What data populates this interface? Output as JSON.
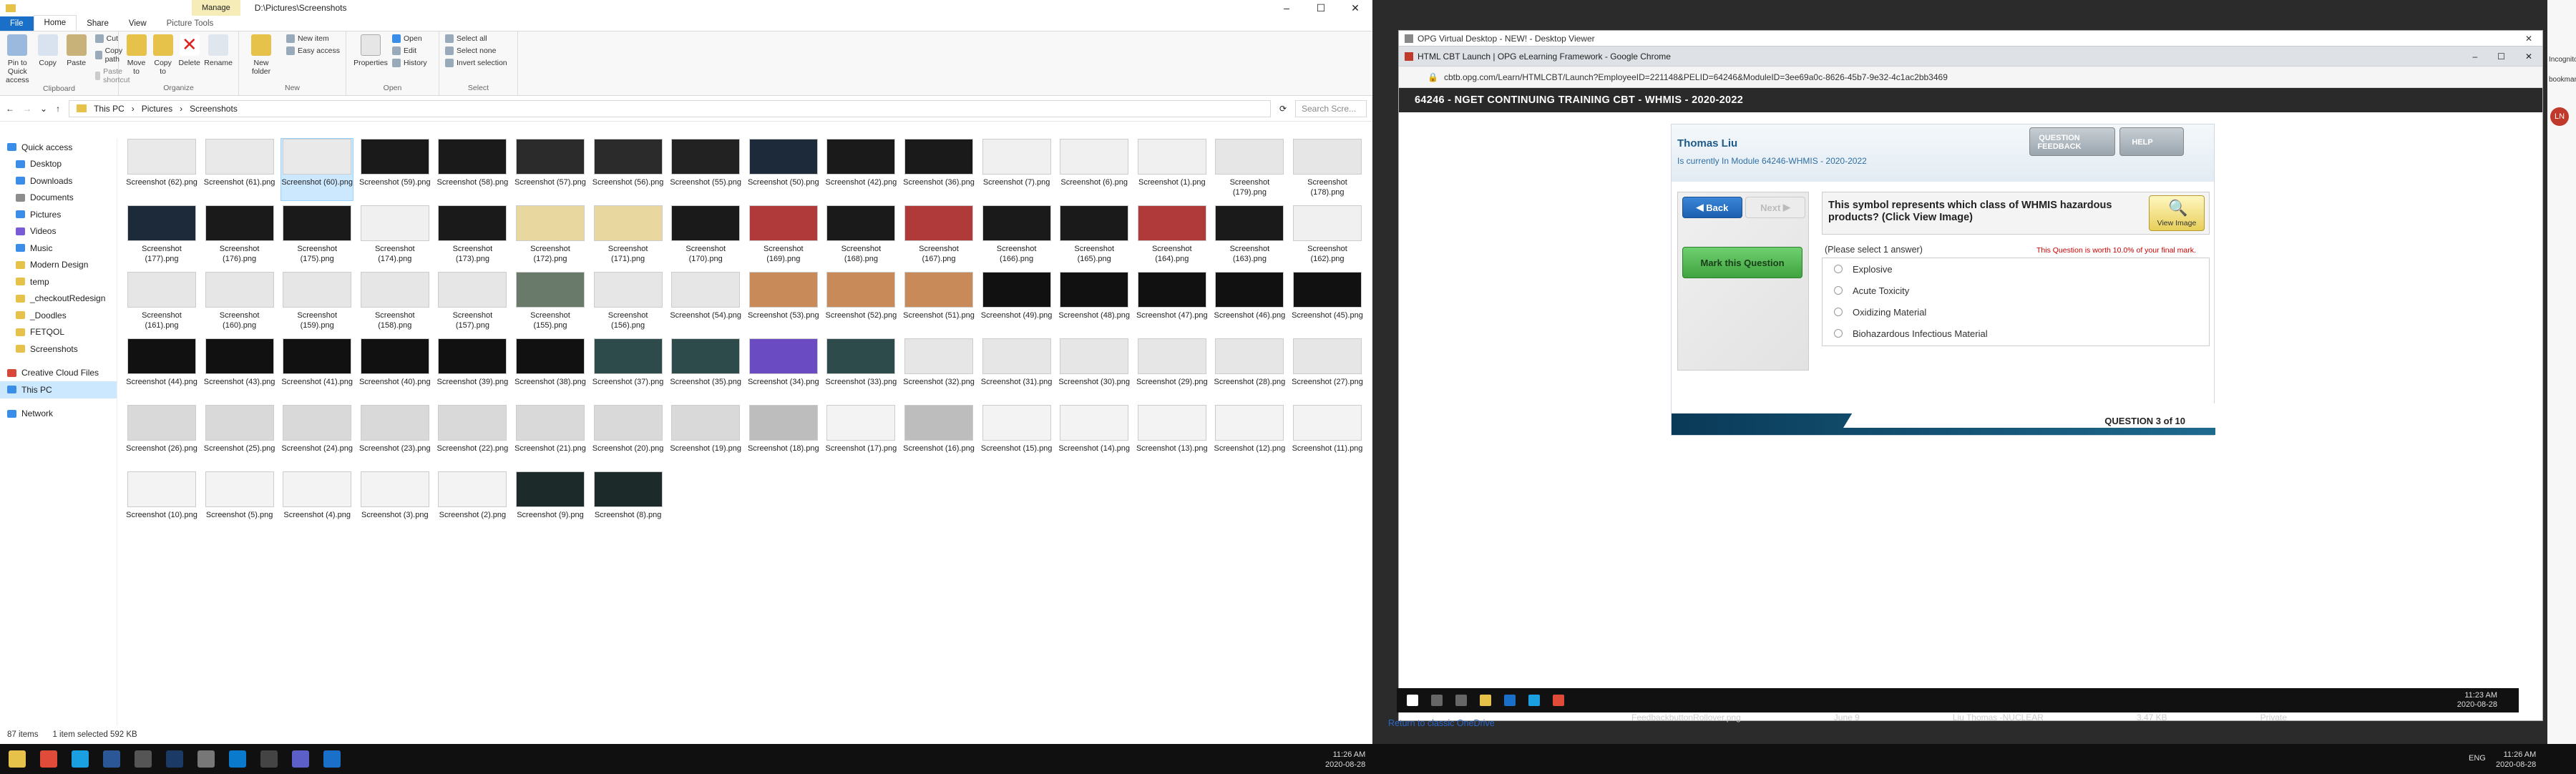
{
  "explorer": {
    "title_path": "D:\\Pictures\\Screenshots",
    "manage_tab": "Manage",
    "picture_tools": "Picture Tools",
    "tabs": [
      "File",
      "Home",
      "Share",
      "View"
    ],
    "ribbon": {
      "clipboard": {
        "pin": "Pin to Quick access",
        "copy": "Copy",
        "paste": "Paste",
        "cut": "Cut",
        "copy_path": "Copy path",
        "paste_shortcut": "Paste shortcut",
        "group": "Clipboard"
      },
      "organize": {
        "move": "Move to",
        "copy": "Copy to",
        "delete": "Delete",
        "rename": "Rename",
        "group": "Organize"
      },
      "new": {
        "new_folder": "New folder",
        "new_item": "New item",
        "easy_access": "Easy access",
        "group": "New"
      },
      "open": {
        "properties": "Properties",
        "open": "Open",
        "edit": "Edit",
        "history": "History",
        "group": "Open"
      },
      "select": {
        "select_all": "Select all",
        "select_none": "Select none",
        "invert": "Invert selection",
        "group": "Select"
      }
    },
    "breadcrumb": [
      "This PC",
      "Pictures",
      "Screenshots"
    ],
    "search_placeholder": "Search Scre...",
    "nav": [
      {
        "label": "Quick access",
        "color": "#3b8ee8"
      },
      {
        "label": "Desktop",
        "color": "#3b8ee8"
      },
      {
        "label": "Downloads",
        "color": "#3b8ee8"
      },
      {
        "label": "Documents",
        "color": "#8d8d8d"
      },
      {
        "label": "Pictures",
        "color": "#3b8ee8"
      },
      {
        "label": "Videos",
        "color": "#7a5bd6"
      },
      {
        "label": "Music",
        "color": "#3b8ee8"
      },
      {
        "label": "Modern Design",
        "color": "#e7c24a"
      },
      {
        "label": "temp",
        "color": "#e7c24a"
      },
      {
        "label": "_checkoutRedesign",
        "color": "#e7c24a"
      },
      {
        "label": "_Doodles",
        "color": "#e7c24a"
      },
      {
        "label": "FETQOL",
        "color": "#e7c24a"
      },
      {
        "label": "Screenshots",
        "color": "#e7c24a"
      },
      {
        "label": "Creative Cloud Files",
        "color": "#d7473a"
      },
      {
        "label": "This PC",
        "color": "#3b8ee8"
      },
      {
        "label": "Network",
        "color": "#3b8ee8"
      }
    ],
    "files": [
      {
        "label": "Screenshot (62).png",
        "thumb": "#e9e9e9"
      },
      {
        "label": "Screenshot (61).png",
        "thumb": "#e9e9e9"
      },
      {
        "label": "Screenshot (60).png",
        "thumb": "#e9e9e9"
      },
      {
        "label": "Screenshot (59).png",
        "thumb": "#1a1a1a"
      },
      {
        "label": "Screenshot (58).png",
        "thumb": "#1a1a1a"
      },
      {
        "label": "Screenshot (57).png",
        "thumb": "#2b2b2b"
      },
      {
        "label": "Screenshot (56).png",
        "thumb": "#2b2b2b"
      },
      {
        "label": "Screenshot (55).png",
        "thumb": "#222"
      },
      {
        "label": "Screenshot (50).png",
        "thumb": "#1c2a3a"
      },
      {
        "label": "Screenshot (42).png",
        "thumb": "#1a1a1a"
      },
      {
        "label": "Screenshot (36).png",
        "thumb": "#1a1a1a"
      },
      {
        "label": "Screenshot (7).png",
        "thumb": "#f0f0f0"
      },
      {
        "label": "Screenshot (6).png",
        "thumb": "#f0f0f0"
      },
      {
        "label": "Screenshot (1).png",
        "thumb": "#f0f0f0"
      },
      {
        "label": "Screenshot (179).png",
        "thumb": "#e6e6e6"
      },
      {
        "label": "Screenshot (178).png",
        "thumb": "#e6e6e6"
      },
      {
        "label": "Screenshot (177).png",
        "thumb": "#1c2a3a"
      },
      {
        "label": "Screenshot (176).png",
        "thumb": "#1a1a1a"
      },
      {
        "label": "Screenshot (175).png",
        "thumb": "#1a1a1a"
      },
      {
        "label": "Screenshot (174).png",
        "thumb": "#f0f0f0"
      },
      {
        "label": "Screenshot (173).png",
        "thumb": "#1a1a1a"
      },
      {
        "label": "Screenshot (172).png",
        "thumb": "#e8d8a0"
      },
      {
        "label": "Screenshot (171).png",
        "thumb": "#e8d8a0"
      },
      {
        "label": "Screenshot (170).png",
        "thumb": "#1a1a1a"
      },
      {
        "label": "Screenshot (169).png",
        "thumb": "#b03a3a"
      },
      {
        "label": "Screenshot (168).png",
        "thumb": "#1a1a1a"
      },
      {
        "label": "Screenshot (167).png",
        "thumb": "#b03a3a"
      },
      {
        "label": "Screenshot (166).png",
        "thumb": "#1a1a1a"
      },
      {
        "label": "Screenshot (165).png",
        "thumb": "#1a1a1a"
      },
      {
        "label": "Screenshot (164).png",
        "thumb": "#b03a3a"
      },
      {
        "label": "Screenshot (163).png",
        "thumb": "#1a1a1a"
      },
      {
        "label": "Screenshot (162).png",
        "thumb": "#f0f0f0"
      },
      {
        "label": "Screenshot (161).png",
        "thumb": "#e6e6e6"
      },
      {
        "label": "Screenshot (160).png",
        "thumb": "#e6e6e6"
      },
      {
        "label": "Screenshot (159).png",
        "thumb": "#e6e6e6"
      },
      {
        "label": "Screenshot (158).png",
        "thumb": "#e6e6e6"
      },
      {
        "label": "Screenshot (157).png",
        "thumb": "#e6e6e6"
      },
      {
        "label": "Screenshot (155).png",
        "thumb": "#6a7a6a"
      },
      {
        "label": "Screenshot (156).png",
        "thumb": "#e6e6e6"
      },
      {
        "label": "Screenshot (54).png",
        "thumb": "#e6e6e6"
      },
      {
        "label": "Screenshot (53).png",
        "thumb": "#c98a5a"
      },
      {
        "label": "Screenshot (52).png",
        "thumb": "#c98a5a"
      },
      {
        "label": "Screenshot (51).png",
        "thumb": "#c98a5a"
      },
      {
        "label": "Screenshot (49).png",
        "thumb": "#111"
      },
      {
        "label": "Screenshot (48).png",
        "thumb": "#111"
      },
      {
        "label": "Screenshot (47).png",
        "thumb": "#111"
      },
      {
        "label": "Screenshot (46).png",
        "thumb": "#111"
      },
      {
        "label": "Screenshot (45).png",
        "thumb": "#111"
      },
      {
        "label": "Screenshot (44).png",
        "thumb": "#111"
      },
      {
        "label": "Screenshot (43).png",
        "thumb": "#111"
      },
      {
        "label": "Screenshot (41).png",
        "thumb": "#111"
      },
      {
        "label": "Screenshot (40).png",
        "thumb": "#111"
      },
      {
        "label": "Screenshot (39).png",
        "thumb": "#111"
      },
      {
        "label": "Screenshot (38).png",
        "thumb": "#111"
      },
      {
        "label": "Screenshot (37).png",
        "thumb": "#2e4b4b"
      },
      {
        "label": "Screenshot (35).png",
        "thumb": "#2e4b4b"
      },
      {
        "label": "Screenshot (34).png",
        "thumb": "#6b4bc2"
      },
      {
        "label": "Screenshot (33).png",
        "thumb": "#2e4b4b"
      },
      {
        "label": "Screenshot (32).png",
        "thumb": "#e6e6e6"
      },
      {
        "label": "Screenshot (31).png",
        "thumb": "#e6e6e6"
      },
      {
        "label": "Screenshot (30).png",
        "thumb": "#e6e6e6"
      },
      {
        "label": "Screenshot (29).png",
        "thumb": "#e6e6e6"
      },
      {
        "label": "Screenshot (28).png",
        "thumb": "#e6e6e6"
      },
      {
        "label": "Screenshot (27).png",
        "thumb": "#e6e6e6"
      },
      {
        "label": "Screenshot (26).png",
        "thumb": "#d9d9d9"
      },
      {
        "label": "Screenshot (25).png",
        "thumb": "#d9d9d9"
      },
      {
        "label": "Screenshot (24).png",
        "thumb": "#d9d9d9"
      },
      {
        "label": "Screenshot (23).png",
        "thumb": "#d9d9d9"
      },
      {
        "label": "Screenshot (22).png",
        "thumb": "#d9d9d9"
      },
      {
        "label": "Screenshot (21).png",
        "thumb": "#d9d9d9"
      },
      {
        "label": "Screenshot (20).png",
        "thumb": "#d9d9d9"
      },
      {
        "label": "Screenshot (19).png",
        "thumb": "#d9d9d9"
      },
      {
        "label": "Screenshot (18).png",
        "thumb": "#bdbdbd"
      },
      {
        "label": "Screenshot (17).png",
        "thumb": "#f3f3f3"
      },
      {
        "label": "Screenshot (16).png",
        "thumb": "#bdbdbd"
      },
      {
        "label": "Screenshot (15).png",
        "thumb": "#f3f3f3"
      },
      {
        "label": "Screenshot (14).png",
        "thumb": "#f3f3f3"
      },
      {
        "label": "Screenshot (13).png",
        "thumb": "#f3f3f3"
      },
      {
        "label": "Screenshot (12).png",
        "thumb": "#f3f3f3"
      },
      {
        "label": "Screenshot (11).png",
        "thumb": "#f3f3f3"
      },
      {
        "label": "Screenshot (10).png",
        "thumb": "#f3f3f3"
      },
      {
        "label": "Screenshot (5).png",
        "thumb": "#f3f3f3"
      },
      {
        "label": "Screenshot (4).png",
        "thumb": "#f3f3f3"
      },
      {
        "label": "Screenshot (3).png",
        "thumb": "#f3f3f3"
      },
      {
        "label": "Screenshot (2).png",
        "thumb": "#f3f3f3"
      },
      {
        "label": "Screenshot (9).png",
        "thumb": "#1c2a2a"
      },
      {
        "label": "Screenshot (8).png",
        "thumb": "#1c2a2a"
      }
    ],
    "selected_index": 2,
    "status": {
      "count": "87 items",
      "selected": "1 item selected  592 KB"
    }
  },
  "vd": {
    "title": "OPG Virtual Desktop - NEW! - Desktop Viewer",
    "chrome_title": "HTML CBT Launch | OPG eLearning Framework - Google Chrome",
    "url": "cbtb.opg.com/Learn/HTMLCBT/Launch?EmployeeID=221148&PELID=64246&ModuleID=3ee69a0c-8626-45b7-9e32-4c1ac2bb3469",
    "course_title": "64246 - NGET CONTINUING TRAINING CBT - WHMIS - 2020-2022",
    "user_name": "Thomas Liu",
    "module_line": "Is currently In Module 64246-WHMIS - 2020-2022",
    "feedback_label": "QUESTION FEEDBACK",
    "help_label": "HELP",
    "back_label": "Back",
    "next_label": "Next",
    "mark_label": "Mark this Question",
    "question": "This symbol represents which class of WHMIS hazardous products? (Click View Image)",
    "view_image_label": "View Image",
    "instruction": "(Please select 1 answer)",
    "worth": "This Question is worth 10.0% of your final mark.",
    "options": [
      "Explosive",
      "Acute Toxicity",
      "Oxidizing Material",
      "Biohazardous Infectious Material"
    ],
    "question_count": "QUESTION 3 of 10",
    "clock_time": "11:23 AM",
    "clock_date": "2020-08-28",
    "onedrive": "Return to classic OneDrive",
    "bg_file": "FeedbackbuttonRollover.png",
    "bg_file_date": "June 9",
    "bg_file_user": "Liu Thomas -NUCLEAR",
    "bg_file_size": "3.47 KB",
    "bg_file_private": "Private"
  },
  "host": {
    "clock_time": "11:26 AM",
    "clock_date": "2020-08-28",
    "clock_time2": "11:26 AM",
    "clock_date2": "2020-08-28",
    "lang": "ENG",
    "side_panel": [
      "Incognito",
      "bookmarks"
    ],
    "avatar": "LN"
  },
  "colors": {
    "file_tab": "#1a6fc9",
    "selection": "#cce8ff",
    "back_btn": "#1b5fb0",
    "mark_btn": "#3fa33f",
    "footer": "#0a3a58"
  }
}
